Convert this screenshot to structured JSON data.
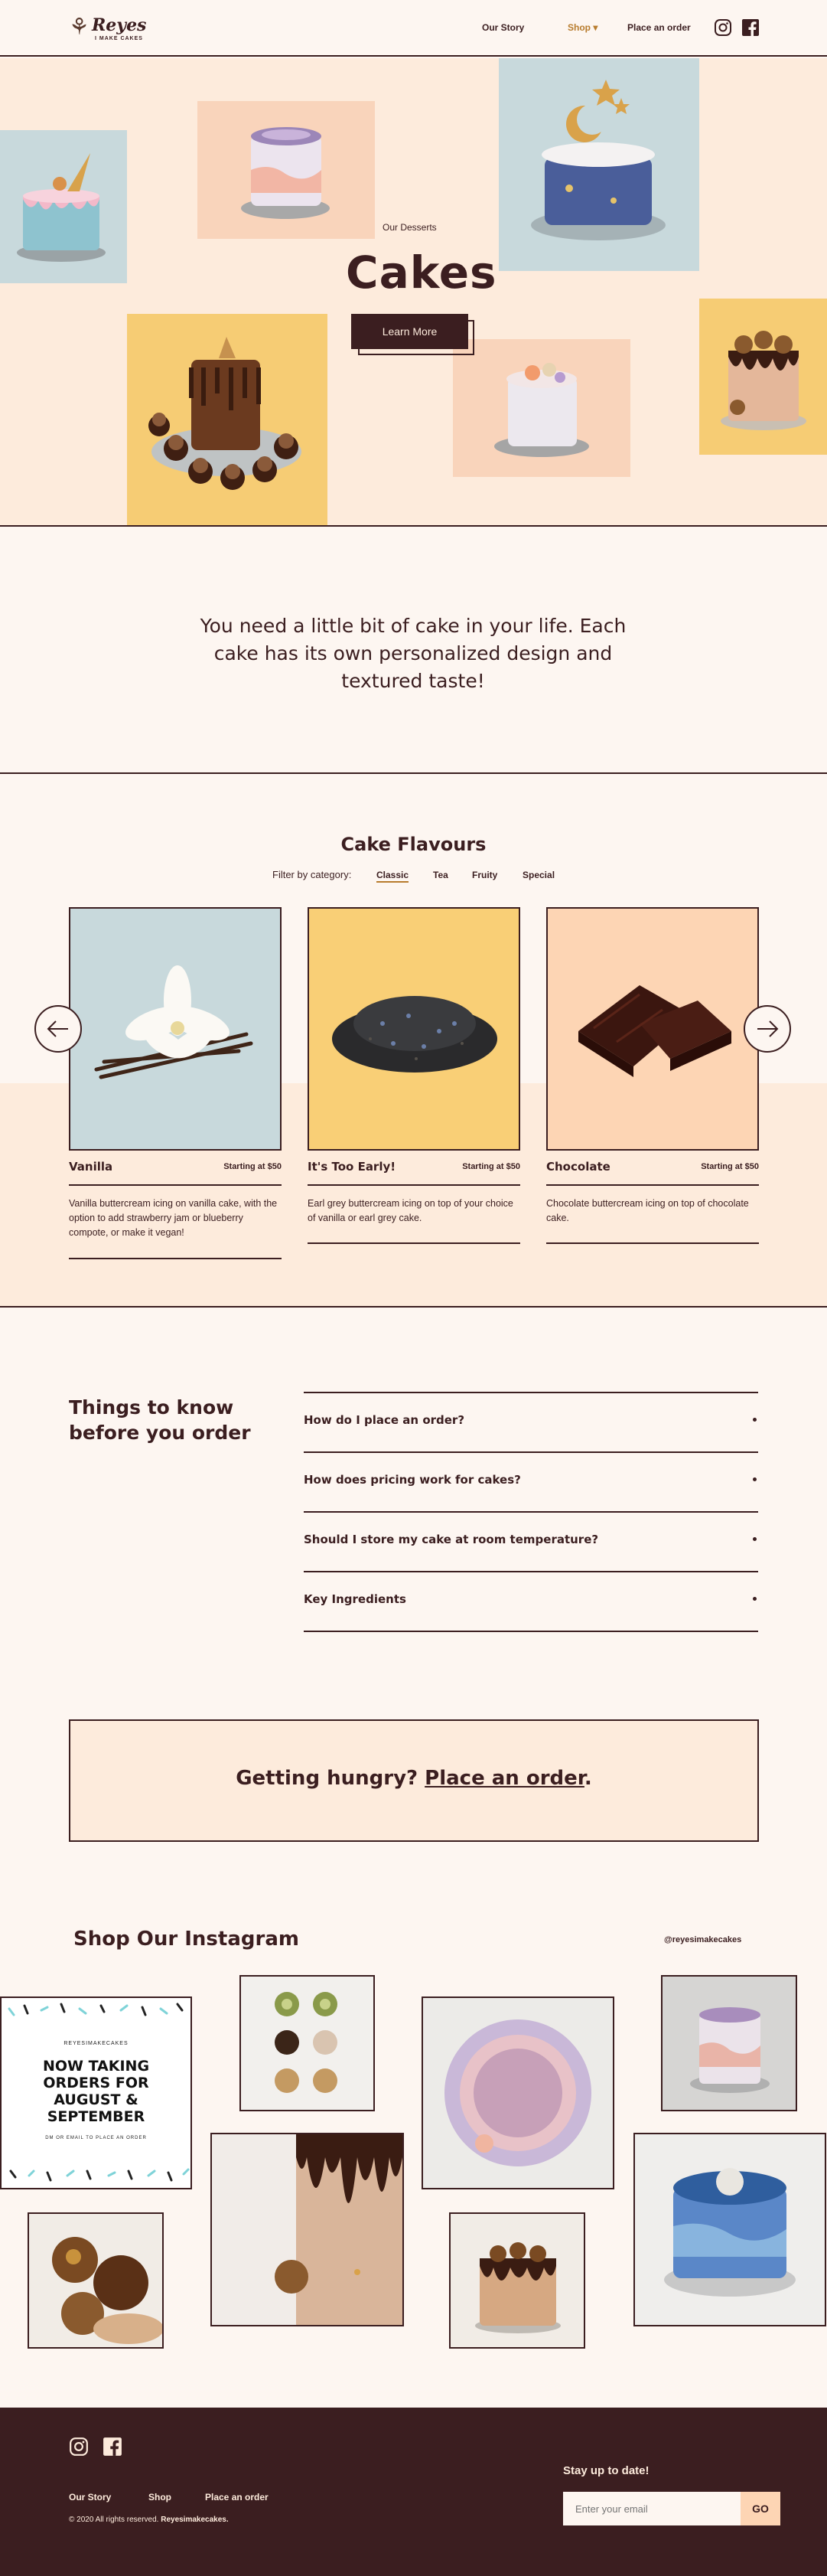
{
  "header": {
    "logo_name": "Reyes",
    "logo_sub": "I MAKE CAKES",
    "nav": [
      {
        "label": "Our Story"
      },
      {
        "label": "Shop ▾"
      },
      {
        "label": "Place an order"
      }
    ],
    "icons": [
      "instagram-icon",
      "facebook-icon"
    ]
  },
  "hero": {
    "eyebrow": "Our Desserts",
    "title": "Cakes",
    "button": "Learn More"
  },
  "quote": "You need a little bit of cake in your life. Each cake has its own personalized design and textured taste!",
  "flavours": {
    "title": "Cake Flavours",
    "filter_label": "Filter by category:",
    "tabs": [
      "Classic",
      "Tea",
      "Fruity",
      "Special"
    ],
    "active_tab": "Classic",
    "cards": [
      {
        "name": "Vanilla",
        "price": "Starting at $50",
        "desc": "Vanilla buttercream icing on vanilla cake, with the option to add strawberry jam or blueberry compote, or make it vegan!",
        "bg": "#c8d9dc"
      },
      {
        "name": "It's Too Early!",
        "price": "Starting at $50",
        "desc": "Earl grey buttercream icing on top of your choice of vanilla or earl grey cake.",
        "bg": "#f9cf76"
      },
      {
        "name": "Chocolate",
        "price": "Starting at $50",
        "desc": "Chocolate buttercream icing on top of chocolate cake.",
        "bg": "#fdd5b4"
      }
    ]
  },
  "faq": {
    "heading": "Things to know before you order",
    "items": [
      {
        "q": "How do I place an order?"
      },
      {
        "q": "How does pricing work for cakes?"
      },
      {
        "q": "Should I store my cake at room temperature?"
      },
      {
        "q": "Key Ingredients"
      }
    ]
  },
  "cta": {
    "text": "Getting hungry? ",
    "link": "Place an order",
    "end": "."
  },
  "instagram": {
    "title": "Shop Our Instagram",
    "handle": "@reyesimakecakes",
    "promo_handle": "REYESIMAKECAKES",
    "promo_title": "NOW TAKING ORDERS FOR AUGUST & SEPTEMBER",
    "promo_sub": "DM OR EMAIL TO PLACE AN ORDER"
  },
  "footer": {
    "links": [
      "Our Story",
      "Shop",
      "Place an order"
    ],
    "copyright": "© 2020 All rights reserved.",
    "copyright_brand": "Reyesimakecakes.",
    "stay_title": "Stay up to date!",
    "email_placeholder": "Enter your email",
    "go": "GO"
  },
  "colors": {
    "brand_dark": "#3b1e20",
    "cream": "#fdf6f1",
    "peach": "#fdebdc",
    "accent_gold": "#b87c2e"
  }
}
